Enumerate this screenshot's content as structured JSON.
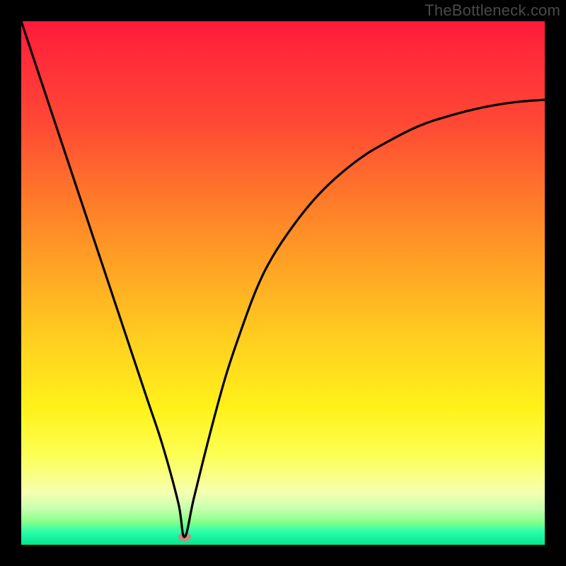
{
  "watermark": "TheBottleneck.com",
  "chart_data": {
    "type": "line",
    "title": "",
    "xlabel": "",
    "ylabel": "",
    "xlim": [
      0,
      100
    ],
    "ylim": [
      0,
      100
    ],
    "grid": false,
    "legend": null,
    "marker": {
      "x": 31.2,
      "y": 1.5,
      "color": "#c98a7c"
    },
    "series": [
      {
        "name": "bottleneck-curve",
        "x": [
          0,
          3,
          6,
          9,
          12,
          15,
          18,
          21,
          24,
          27,
          30,
          31.2,
          33,
          36,
          39,
          42,
          45,
          48,
          52,
          56,
          60,
          65,
          70,
          76,
          82,
          88,
          94,
          100
        ],
        "values": [
          100,
          91,
          82,
          73,
          64,
          55,
          46,
          37,
          28,
          19,
          8,
          1.5,
          9,
          21,
          32,
          41,
          49,
          55,
          61,
          66,
          70,
          74,
          77,
          80,
          82,
          83.5,
          84.5,
          85
        ]
      }
    ],
    "gradient_stops": [
      {
        "pos": 0,
        "color": "#ff1a3a"
      },
      {
        "pos": 0.06,
        "color": "#ff2a3a"
      },
      {
        "pos": 0.2,
        "color": "#ff4a34"
      },
      {
        "pos": 0.34,
        "color": "#ff7a2a"
      },
      {
        "pos": 0.48,
        "color": "#ffa724"
      },
      {
        "pos": 0.62,
        "color": "#ffd21f"
      },
      {
        "pos": 0.74,
        "color": "#fff21a"
      },
      {
        "pos": 0.83,
        "color": "#fcff55"
      },
      {
        "pos": 0.9,
        "color": "#f6ffb0"
      },
      {
        "pos": 0.93,
        "color": "#c9ffb0"
      },
      {
        "pos": 0.955,
        "color": "#8bff8b"
      },
      {
        "pos": 0.975,
        "color": "#2bffa8"
      },
      {
        "pos": 1.0,
        "color": "#00e78f"
      }
    ]
  }
}
